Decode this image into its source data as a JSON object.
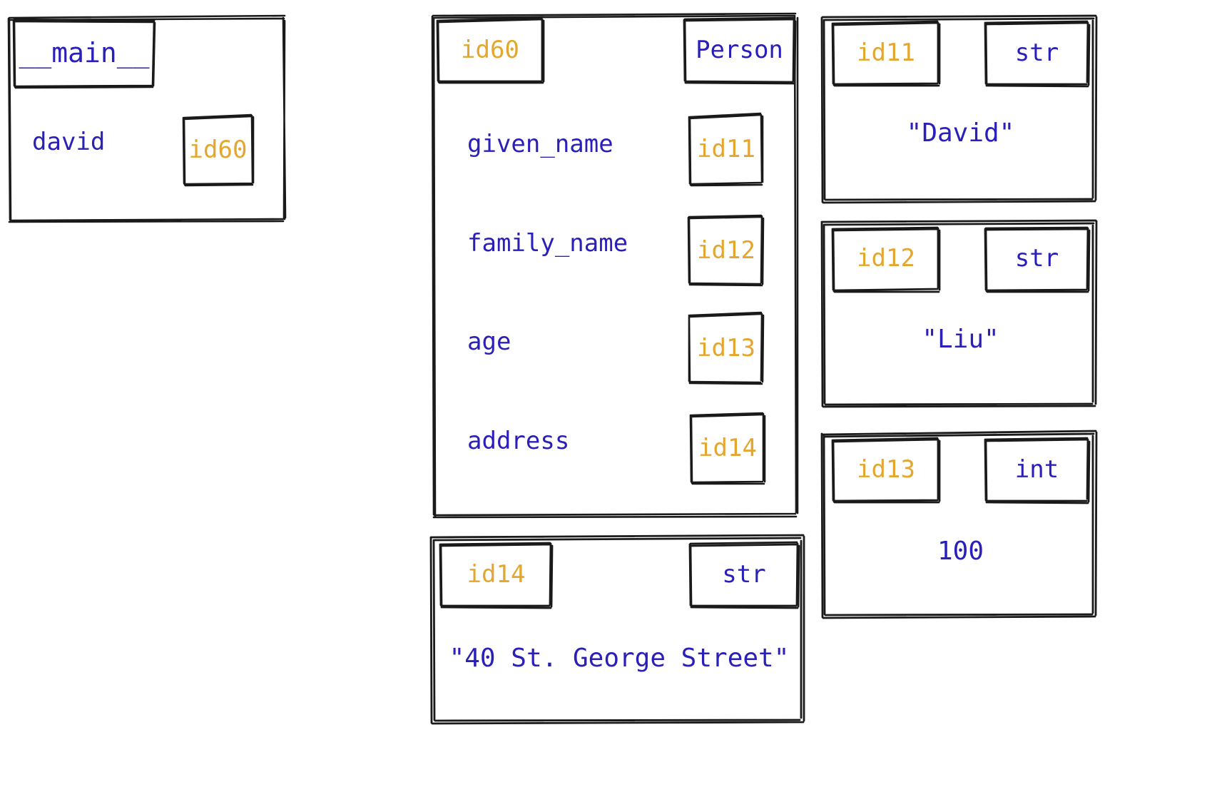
{
  "diagram": {
    "title": "python-memory-model",
    "colors": {
      "id_text": "#E3A62F",
      "value_text": "#2A1FB8",
      "stroke": "#1a1a1a",
      "background": "#ffffff"
    },
    "frame": {
      "name": "__main__",
      "variables": [
        {
          "name": "david",
          "value_id": "id60"
        }
      ]
    },
    "object_person": {
      "id": "id60",
      "type": "Person",
      "attributes": [
        {
          "name": "given_name",
          "value_id": "id11"
        },
        {
          "name": "family_name",
          "value_id": "id12"
        },
        {
          "name": "age",
          "value_id": "id13"
        },
        {
          "name": "address",
          "value_id": "id14"
        }
      ]
    },
    "objects": [
      {
        "id": "id11",
        "type": "str",
        "value": "\"David\""
      },
      {
        "id": "id12",
        "type": "str",
        "value": "\"Liu\""
      },
      {
        "id": "id13",
        "type": "int",
        "value": "100"
      },
      {
        "id": "id14",
        "type": "str",
        "value": "\"40 St. George Street\""
      }
    ]
  }
}
